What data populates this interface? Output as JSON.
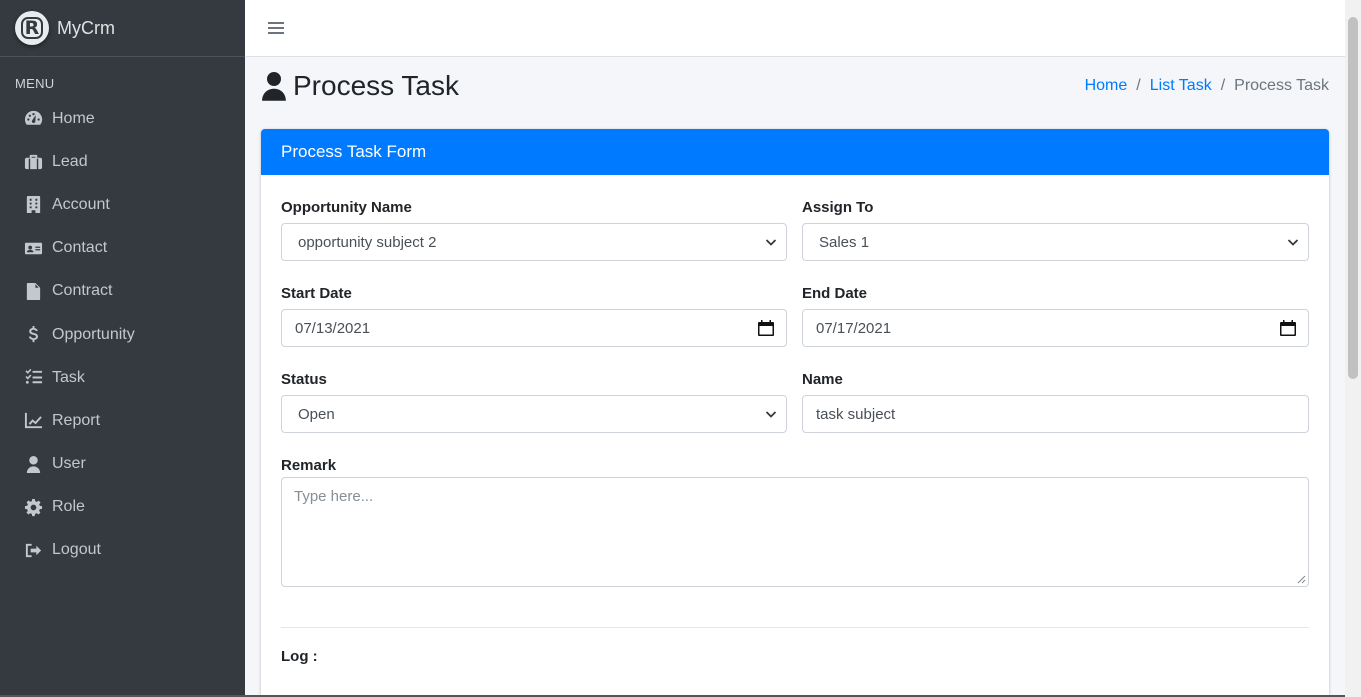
{
  "brand": {
    "name": "MyCrm",
    "logo_letter": "R"
  },
  "sidebar": {
    "header": "MENU",
    "items": [
      {
        "label": "Home",
        "icon": "tachometer-icon"
      },
      {
        "label": "Lead",
        "icon": "briefcase-icon"
      },
      {
        "label": "Account",
        "icon": "building-icon"
      },
      {
        "label": "Contact",
        "icon": "address-card-icon"
      },
      {
        "label": "Contract",
        "icon": "file-contract-icon"
      },
      {
        "label": "Opportunity",
        "icon": "dollar-icon"
      },
      {
        "label": "Task",
        "icon": "tasks-icon"
      },
      {
        "label": "Report",
        "icon": "chart-line-icon"
      },
      {
        "label": "User",
        "icon": "user-icon"
      },
      {
        "label": "Role",
        "icon": "gear-icon"
      },
      {
        "label": "Logout",
        "icon": "sign-out-icon"
      }
    ]
  },
  "page": {
    "title": "Process Task",
    "breadcrumb": {
      "home": "Home",
      "list": "List Task",
      "current": "Process Task",
      "separator": "/"
    }
  },
  "form": {
    "header": "Process Task Form",
    "opportunity": {
      "label": "Opportunity Name",
      "value": "opportunity subject 2"
    },
    "assign_to": {
      "label": "Assign To",
      "value": "Sales 1"
    },
    "start_date": {
      "label": "Start Date",
      "value": "07/13/2021"
    },
    "end_date": {
      "label": "End Date",
      "value": "07/17/2021"
    },
    "status": {
      "label": "Status",
      "value": "Open"
    },
    "name": {
      "label": "Name",
      "value": "task subject"
    },
    "remark": {
      "label": "Remark",
      "placeholder": "Type here..."
    },
    "log_label": "Log :"
  },
  "colors": {
    "sidebar_bg": "#343a40",
    "primary": "#007bff",
    "content_bg": "#f4f6f9"
  }
}
